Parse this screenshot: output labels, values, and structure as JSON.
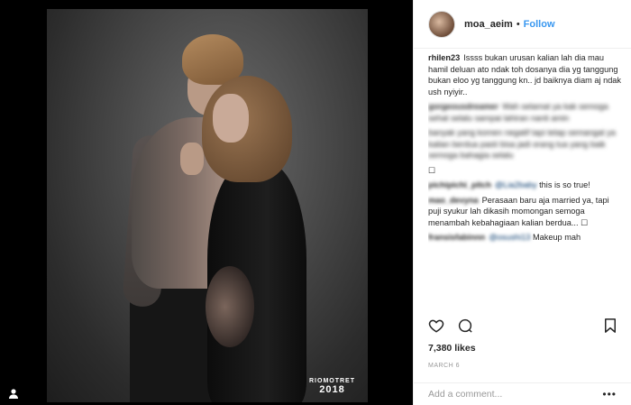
{
  "post": {
    "username": "moa_aeim",
    "dot": "•",
    "follow_label": "Follow",
    "watermark_name": "RIOMOTRET",
    "watermark_year": "2018"
  },
  "comments": [
    {
      "user": "rhilen23",
      "text": "Issss bukan urusan kalian lah dia mau hamil deluan ato ndak toh dosanya dia yg tanggung bukan eloo yg tanggung kn.. jd baiknya diam aj ndak ush nyiyir..",
      "blurred": false
    },
    {
      "user": "gorgeousdreamer",
      "text": "Wah selamat ya kak semoga sehat selalu sampai lahiran nanti amin",
      "blurred": true
    },
    {
      "user": "",
      "text": "banyak yang komen negatif tapi tetap semangat ya kalian berdua pasti bisa jadi orang tua yang baik semoga bahagia selalu",
      "blurred": true
    },
    {
      "user": "",
      "text": "☐",
      "blurred": false
    },
    {
      "user": "pichipichi_pitch",
      "mention": "@Lia2baby",
      "text": "this is so true!",
      "blurred_user": true
    },
    {
      "user": "mao_devyna",
      "text": "Perasaan baru aja married ya, tapi puji syukur lah dikasih momongan semoga menambah kebahagiaan kalian berdua... ☐",
      "blurred_user": true
    },
    {
      "user": "fransisfabinnn",
      "mention": "@osushi13",
      "text": "Makeup mah",
      "blurred_user": true
    }
  ],
  "likes": "7,380 likes",
  "date": "MARCH 6",
  "add_comment_placeholder": "Add a comment...",
  "more_glyph": "•••",
  "icons": {
    "heart": "heart-icon",
    "comment": "comment-icon",
    "save": "save-icon",
    "tag": "tag-person-icon"
  }
}
